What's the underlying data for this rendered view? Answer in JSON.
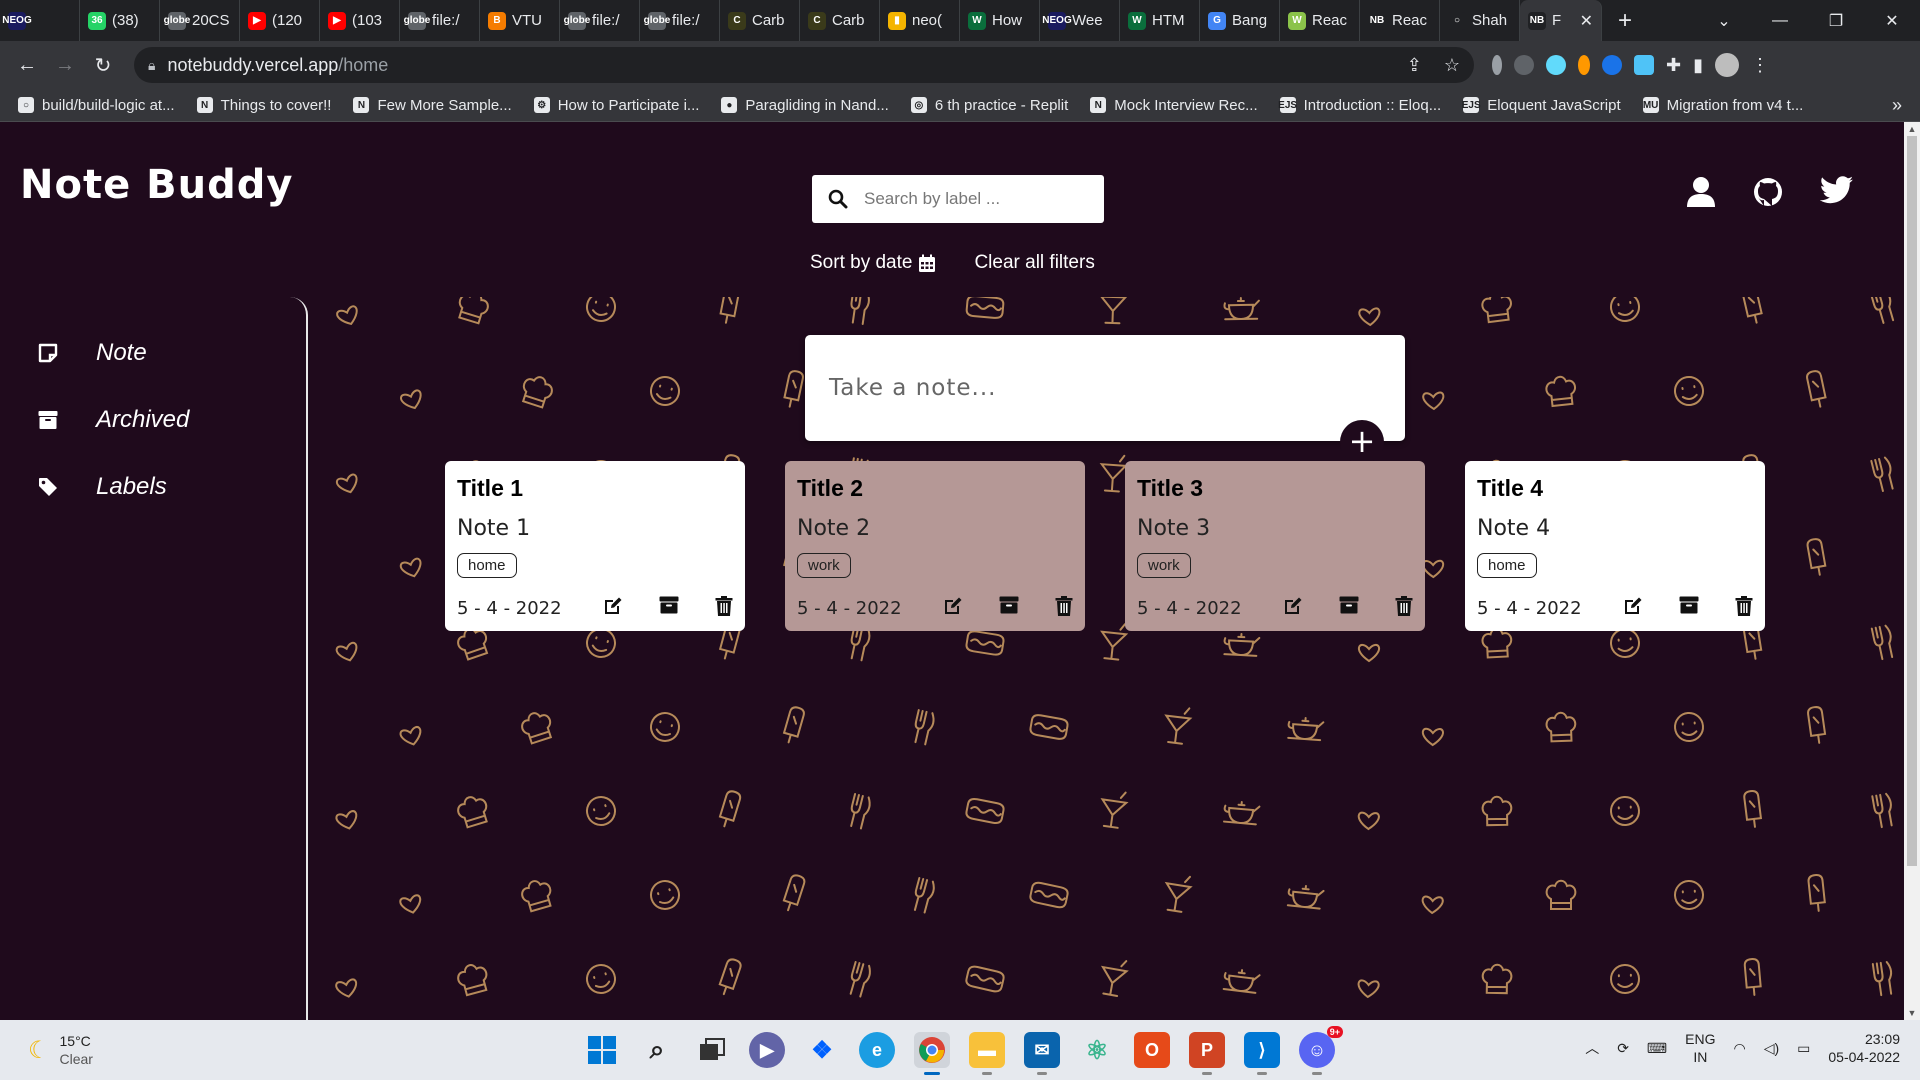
{
  "browser": {
    "tabs": [
      {
        "title": "",
        "fav": "NEOG",
        "color": "#1a1a5e"
      },
      {
        "title": "(38)",
        "fav": "36",
        "color": "#25d366"
      },
      {
        "title": "20CS",
        "fav": "globe",
        "color": "#5f6368"
      },
      {
        "title": "(120",
        "fav": "▶",
        "color": "#ff0000"
      },
      {
        "title": "(103",
        "fav": "▶",
        "color": "#ff0000"
      },
      {
        "title": "file:/",
        "fav": "globe",
        "color": "#5f6368"
      },
      {
        "title": "VTU",
        "fav": "B",
        "color": "#f57c00"
      },
      {
        "title": "file:/",
        "fav": "globe",
        "color": "#5f6368"
      },
      {
        "title": "file:/",
        "fav": "globe",
        "color": "#5f6368"
      },
      {
        "title": "Carb",
        "fav": "C",
        "color": "#3a3a1a"
      },
      {
        "title": "Carb",
        "fav": "C",
        "color": "#3a3a1a"
      },
      {
        "title": "neo(",
        "fav": "▮",
        "color": "#f4b400"
      },
      {
        "title": "How",
        "fav": "W",
        "color": "#0a6e3c"
      },
      {
        "title": "Wee",
        "fav": "NEOG",
        "color": "#1a1a5e"
      },
      {
        "title": "HTM",
        "fav": "W",
        "color": "#0a6e3c"
      },
      {
        "title": "Bang",
        "fav": "G",
        "color": "#4285f4"
      },
      {
        "title": "Reac",
        "fav": "W",
        "color": "#8bc34a"
      },
      {
        "title": "Reac",
        "fav": "NB",
        "color": "#202124"
      },
      {
        "title": "Shah",
        "fav": "○",
        "color": "#202124"
      },
      {
        "title": "F",
        "fav": "NB",
        "color": "#202124",
        "active": true
      }
    ],
    "url_host": "notebuddy.vercel.app",
    "url_path": "/home",
    "bookmarks": [
      {
        "label": "build/build-logic at...",
        "fav": "○"
      },
      {
        "label": "Things to cover!!",
        "fav": "N"
      },
      {
        "label": "Few More Sample...",
        "fav": "N"
      },
      {
        "label": "How to Participate i...",
        "fav": "⚙"
      },
      {
        "label": "Paragliding in Nand...",
        "fav": "●"
      },
      {
        "label": "6 th practice - Replit",
        "fav": "◎"
      },
      {
        "label": "Mock Interview Rec...",
        "fav": "N"
      },
      {
        "label": "Introduction :: Eloq...",
        "fav": "EJS"
      },
      {
        "label": "Eloquent JavaScript",
        "fav": "EJS"
      },
      {
        "label": "Migration from v4 t...",
        "fav": "MU"
      }
    ]
  },
  "app": {
    "logo": "Note Buddy",
    "search_placeholder": "Search by label ...",
    "sort_label": "Sort by date",
    "clear_label": "Clear all filters",
    "sidebar": [
      {
        "label": "Note",
        "icon": "note-icon"
      },
      {
        "label": "Archived",
        "icon": "archive-icon"
      },
      {
        "label": "Labels",
        "icon": "tag-icon"
      }
    ],
    "take_note_placeholder": "Take a note...",
    "notes": [
      {
        "title": "Title 1",
        "body": "Note 1",
        "label": "home",
        "date": "5 - 4 - 2022",
        "color": "#ffffff"
      },
      {
        "title": "Title 2",
        "body": "Note 2",
        "label": "work",
        "date": "5 - 4 - 2022",
        "color": "#b59896"
      },
      {
        "title": "Title 3",
        "body": "Note 3",
        "label": "work",
        "date": "5 - 4 - 2022",
        "color": "#b59896"
      },
      {
        "title": "Title 4",
        "body": "Note 4",
        "label": "home",
        "date": "5 - 4 - 2022",
        "color": "#ffffff"
      }
    ],
    "colors": {
      "background": "#1f0a1c",
      "pattern": "#b68a5a",
      "accent": "#ffffff"
    }
  },
  "taskbar": {
    "temperature": "15°C",
    "condition": "Clear",
    "apps": [
      "windows-start",
      "search",
      "task-view",
      "teams-chat",
      "dropbox",
      "edge",
      "chrome",
      "file-explorer",
      "mail",
      "atom",
      "office",
      "powerpoint",
      "vscode",
      "discord"
    ],
    "lang_top": "ENG",
    "lang_bottom": "IN",
    "time": "23:09",
    "date": "05-04-2022",
    "discord_badge": "9+"
  }
}
